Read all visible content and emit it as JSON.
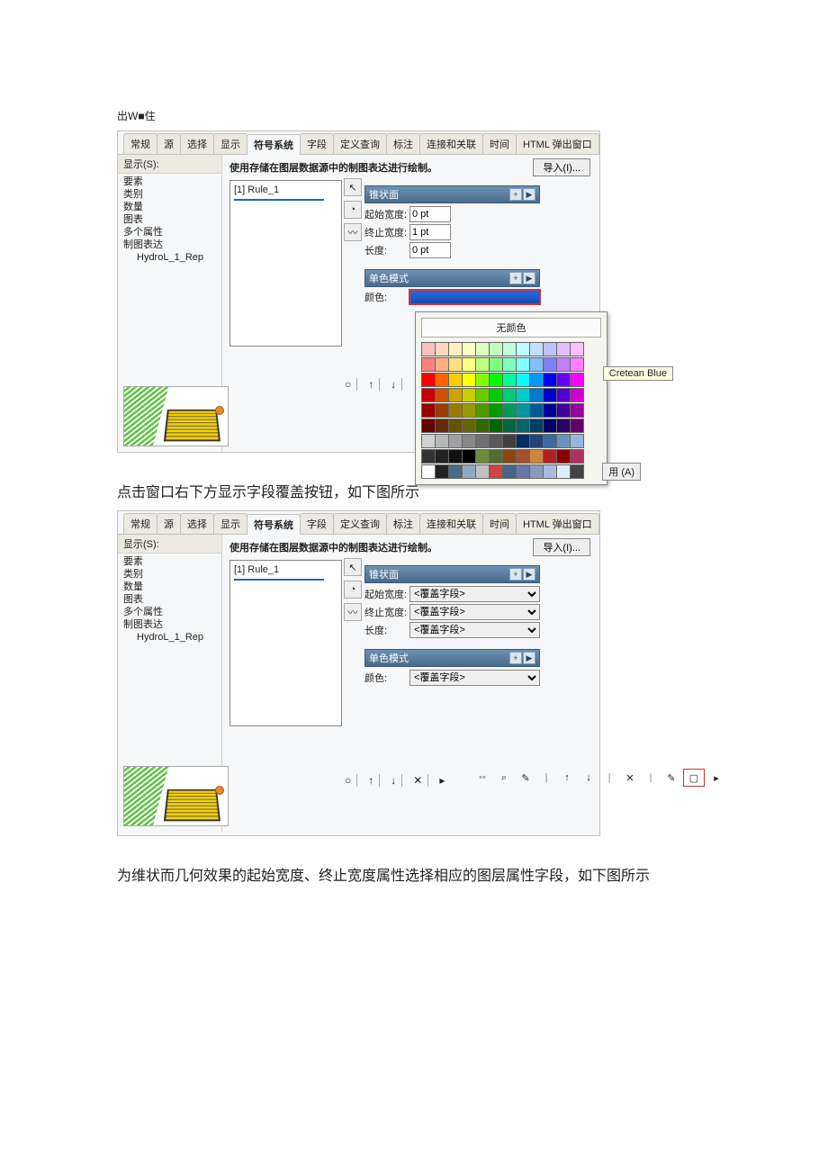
{
  "header": "出W■住",
  "caption1": "点击窗口右下方显示字段覆盖按钮，如下图所示",
  "caption2": "为维状而几何效果的起始宽度、终止宽度属性选择相应的图层属性字段，如下图所示",
  "tabs": [
    "常规",
    "源",
    "选择",
    "显示",
    "符号系统",
    "字段",
    "定义查询",
    "标注",
    "连接和关联",
    "时间",
    "HTML 弹出窗口"
  ],
  "activeTab": "符号系统",
  "sidebar": {
    "show": "显示(S):",
    "items": [
      "要素",
      "类别",
      "数量",
      "图表",
      "多个属性",
      "制图表达"
    ],
    "child": "HydroL_1_Rep"
  },
  "main": {
    "title1": "使用存储在图层数据源中的制图表达进行绘制。",
    "import": "导入(I)...",
    "rule": "[1] Rule_1"
  },
  "panel": {
    "headerA": "锥状面",
    "startWidth": "起始宽度:",
    "endWidth": "终止宽度:",
    "length": "长度:",
    "value0": "0 pt",
    "value1": "1 pt",
    "headerB": "单色模式",
    "colorLabel": "颜色:",
    "override": "<覆盖字段>"
  },
  "colorPopup": {
    "noColor": "无颜色",
    "hoverName": "Cretean Blue",
    "applyBtn": "用 (A)"
  },
  "paletteColors": [
    "#ffc0c0",
    "#ffd8c0",
    "#fff0c0",
    "#ffffc0",
    "#e0ffc0",
    "#c0ffc0",
    "#c0ffe0",
    "#c0ffff",
    "#c0e0ff",
    "#c0c0ff",
    "#e0c0ff",
    "#ffc0ff",
    "#ff8080",
    "#ffb080",
    "#ffe080",
    "#ffff80",
    "#c0ff80",
    "#80ff80",
    "#80ffc0",
    "#80ffff",
    "#80c0ff",
    "#8080ff",
    "#c080ff",
    "#ff80ff",
    "#ff0000",
    "#ff6600",
    "#ffcc00",
    "#ffff00",
    "#80ff00",
    "#00ff00",
    "#00ff99",
    "#00ffff",
    "#0099ff",
    "#0000ff",
    "#6600ff",
    "#ff00ff",
    "#cc0000",
    "#cc5200",
    "#cca300",
    "#cccc00",
    "#66cc00",
    "#00cc00",
    "#00cc7a",
    "#00cccc",
    "#007acc",
    "#0000cc",
    "#5200cc",
    "#cc00cc",
    "#990000",
    "#993d00",
    "#997a00",
    "#999900",
    "#4d9900",
    "#009900",
    "#00995c",
    "#009999",
    "#005c99",
    "#000099",
    "#3d0099",
    "#990099",
    "#660000",
    "#662900",
    "#665200",
    "#666600",
    "#336600",
    "#006600",
    "#00663d",
    "#006666",
    "#003d66",
    "#000066",
    "#290066",
    "#660066",
    "#d0d0d0",
    "#b8b8b8",
    "#a0a0a0",
    "#888888",
    "#707070",
    "#585858",
    "#404040",
    "#002f66",
    "#224477",
    "#3a6aa0",
    "#6a93c1",
    "#97b7da",
    "#333333",
    "#222222",
    "#111111",
    "#000000",
    "#6e8b3d",
    "#556b2f",
    "#8b4513",
    "#a0522d",
    "#cd853f",
    "#b22222",
    "#8b0000",
    "#b03060",
    "#ffffff",
    "#222222",
    "#4a6a8a",
    "#8fa9c2",
    "#c0c0c0",
    "#cc4444",
    "#446688",
    "#6677aa",
    "#8899bb",
    "#aabbdd",
    "#ddeeff",
    "#444444"
  ]
}
